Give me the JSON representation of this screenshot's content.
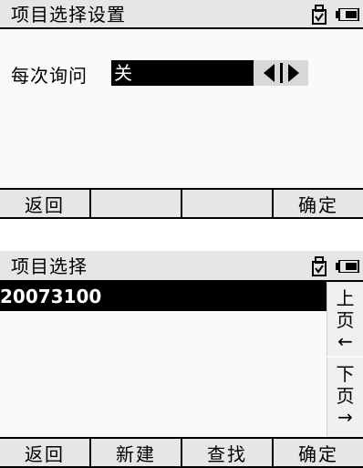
{
  "screen1": {
    "title": "项目选择设置",
    "field": {
      "label": "每次询问",
      "value": "关"
    },
    "softkeys": [
      "返回",
      "",
      "",
      "确定"
    ]
  },
  "screen2": {
    "title": "项目选择",
    "list": {
      "items": [
        "20073100"
      ]
    },
    "pager": {
      "up_line1": "上",
      "up_line2": "页",
      "up_arrow": "←",
      "down_line1": "下",
      "down_line2": "页",
      "down_arrow": "→"
    },
    "softkeys": [
      "返回",
      "新建",
      "查找",
      "确定"
    ]
  },
  "icons": {
    "usb": "usb-drive-icon",
    "battery": "battery-icon",
    "spinner_left": "triangle-left-icon",
    "spinner_right": "triangle-right-icon"
  }
}
